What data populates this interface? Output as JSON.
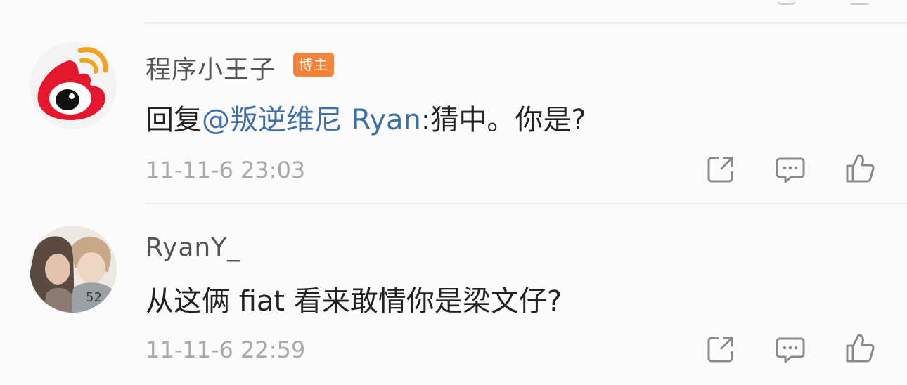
{
  "colors": {
    "mention": "#3f6fa7",
    "badge": "#f5843a",
    "timestamp": "#a9a9a9",
    "icon": "#8a8a8a"
  },
  "comments": [
    {
      "username": "程序小王子",
      "badge": "博主",
      "reply_prefix": "回复",
      "mention": "@叛逆维尼 Ryan",
      "text": ":猜中。你是?",
      "time": "11-11-6 23:03",
      "avatar_icon": "weibo-logo-icon"
    },
    {
      "username": "RyanY_",
      "text": "从这俩 fiat 看来敢情你是梁文仔?",
      "time": "11-11-6 22:59",
      "avatar_icon": "user-photo-avatar"
    }
  ],
  "actions": [
    "share-icon",
    "comment-icon",
    "like-icon"
  ]
}
